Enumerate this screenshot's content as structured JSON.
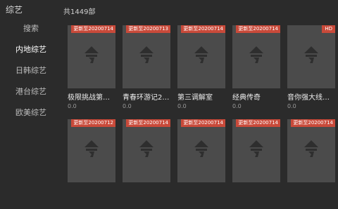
{
  "app": {
    "title": "综艺"
  },
  "sidebar": {
    "items": [
      {
        "label": "搜索",
        "active": false
      },
      {
        "label": "内地综艺",
        "active": true
      },
      {
        "label": "日韩综艺",
        "active": false
      },
      {
        "label": "港台综艺",
        "active": false
      },
      {
        "label": "欧美综艺",
        "active": false
      }
    ]
  },
  "main": {
    "count": "共1449部",
    "cards": [
      {
        "badge": "更新至20200714",
        "title": "极限挑战第…",
        "rating": "0.0",
        "icon": "placeholder-logo-icon"
      },
      {
        "badge": "更新至20200713",
        "title": "青春环游记2…",
        "rating": "0.0",
        "icon": "placeholder-logo-icon"
      },
      {
        "badge": "更新至20200714",
        "title": "第三调解室",
        "rating": "0.0",
        "icon": "placeholder-logo-icon"
      },
      {
        "badge": "更新至20200714",
        "title": "经典传奇",
        "rating": "0.0",
        "icon": "placeholder-logo-icon"
      },
      {
        "badge": "HD",
        "title": "音你强大线…",
        "rating": "0.0",
        "icon": "placeholder-logo-icon"
      },
      {
        "badge": "更新至20200712",
        "title": "",
        "rating": "",
        "icon": "placeholder-logo-icon"
      },
      {
        "badge": "更新至20200714",
        "title": "",
        "rating": "",
        "icon": "placeholder-logo-icon"
      },
      {
        "badge": "更新至20200714",
        "title": "",
        "rating": "",
        "icon": "placeholder-logo-icon"
      },
      {
        "badge": "更新至20200714",
        "title": "",
        "rating": "",
        "icon": "placeholder-logo-icon"
      },
      {
        "badge": "更新至20200714",
        "title": "",
        "rating": "",
        "icon": "placeholder-logo-icon"
      }
    ]
  },
  "colors": {
    "background": "#2b2b2b",
    "poster": "#4b4b4b",
    "badge": "#c94a3a",
    "placeholder": "#2e2e2e"
  }
}
